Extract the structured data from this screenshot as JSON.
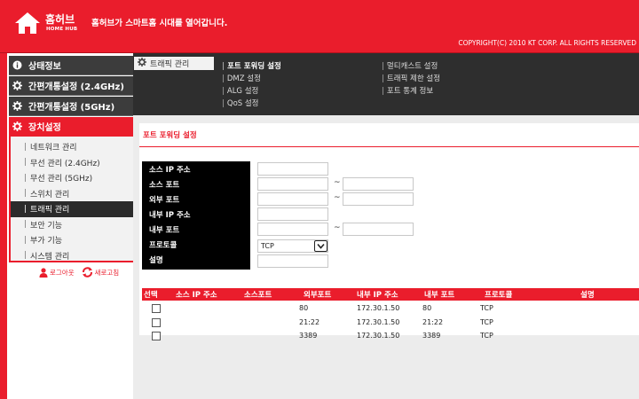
{
  "header": {
    "logo_name": "홈허브",
    "logo_sub": "HOME HUB",
    "tagline": "홈허브가 스마트홈 시대를 열어갑니다.",
    "copyright": "COPYRIGHT(C) 2010 KT CORP.  ALL RIGHTS RESERVED"
  },
  "sidebar": {
    "groups": [
      {
        "label": "상태정보",
        "icon": "info-icon"
      },
      {
        "label": "간편개통설정 (2.4GHz)",
        "icon": "gear-icon"
      },
      {
        "label": "간편개통설정 (5GHz)",
        "icon": "gear-icon"
      },
      {
        "label": "장치설정",
        "icon": "gear-icon"
      }
    ],
    "items": [
      {
        "label": "네트워크 관리"
      },
      {
        "label": "무선 관리 (2.4GHz)"
      },
      {
        "label": "무선 관리 (5GHz)"
      },
      {
        "label": "스위치 관리"
      },
      {
        "label": "트래픽 관리"
      },
      {
        "label": "보안 기능"
      },
      {
        "label": "부가 기능"
      },
      {
        "label": "시스템 관리"
      }
    ],
    "logout": "로그아웃",
    "refresh": "새로고침"
  },
  "tabbar": {
    "current": "트래픽 관리",
    "links": [
      {
        "label": "포트 포워딩 설정"
      },
      {
        "label": "DMZ 설정"
      },
      {
        "label": "ALG 설정"
      },
      {
        "label": "QoS 설정"
      },
      {
        "label": "멀티캐스트 설정"
      },
      {
        "label": "트래픽 제한 설정"
      },
      {
        "label": "포트 통계 정보"
      }
    ]
  },
  "form": {
    "section_title": "포트 포워딩 설정",
    "labels": {
      "source_ip": "소스 IP 주소",
      "source_port": "소스 포트",
      "external_port": "외부 포트",
      "internal_ip": "내부 IP 주소",
      "internal_port": "내부 포트",
      "protocol": "프로토콜",
      "description": "설명"
    },
    "tilde": "~",
    "values": {
      "source_ip": "",
      "source_port_start": "",
      "source_port_end": "",
      "external_port_start": "",
      "external_port_end": "",
      "internal_ip": "",
      "internal_port_start": "",
      "internal_port_end": "",
      "protocol": "TCP",
      "description": ""
    }
  },
  "list": {
    "headers": [
      "선택",
      "소스 IP 주소",
      "소스포트",
      "외부포트",
      "내부 IP 주소",
      "내부 포트",
      "프로토콜",
      "설명"
    ],
    "rows": [
      {
        "checked": false,
        "source_ip": "",
        "source_port": "",
        "external_port": "80",
        "internal_ip": "172.30.1.50",
        "internal_port": "80",
        "protocol": "TCP",
        "description": ""
      },
      {
        "checked": false,
        "source_ip": "",
        "source_port": "",
        "external_port": "21:22",
        "internal_ip": "172.30.1.50",
        "internal_port": "21:22",
        "protocol": "TCP",
        "description": ""
      },
      {
        "checked": false,
        "source_ip": "",
        "source_port": "",
        "external_port": "3389",
        "internal_ip": "172.30.1.50",
        "internal_port": "3389",
        "protocol": "TCP",
        "description": ""
      }
    ]
  },
  "colors": {
    "brand_red": "#ea1d2c",
    "menu_dark": "#3c3c3c",
    "tabbar_dark": "#2e2e2e"
  }
}
